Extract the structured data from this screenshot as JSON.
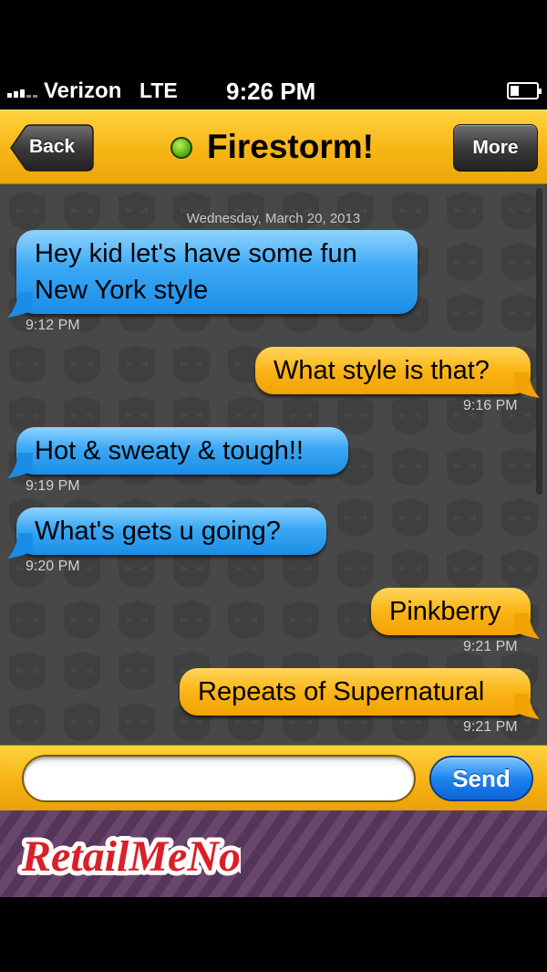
{
  "status_bar": {
    "carrier": "Verizon",
    "network": "LTE",
    "time": "9:26 PM",
    "battery_level": 0.35
  },
  "nav": {
    "back_label": "Back",
    "title": "Firestorm!",
    "more_label": "More",
    "online_color": "#5cb814"
  },
  "chat": {
    "date": "Wednesday, March 20, 2013",
    "messages": [
      {
        "direction": "incoming",
        "text_lines": [
          "Hey kid let's have some fun",
          "New York style"
        ],
        "time": "9:12 PM"
      },
      {
        "direction": "outgoing",
        "text_lines": [
          "What style is that?"
        ],
        "time": "9:16 PM"
      },
      {
        "direction": "incoming",
        "text_lines": [
          "Hot & sweaty & tough!!"
        ],
        "time": "9:19 PM"
      },
      {
        "direction": "incoming",
        "text_lines": [
          "What's gets u going?"
        ],
        "time": "9:20 PM"
      },
      {
        "direction": "outgoing",
        "text_lines": [
          "Pinkberry"
        ],
        "time": "9:21 PM"
      },
      {
        "direction": "outgoing",
        "text_lines": [
          "Repeats of Supernatural"
        ],
        "time": "9:21 PM"
      }
    ]
  },
  "composer": {
    "input_value": "",
    "send_label": "Send"
  },
  "ad": {
    "brand": "RetailMeNot"
  },
  "colors": {
    "accent_yellow": "#f7b515",
    "incoming_bubble": "#3ba8f5",
    "outgoing_bubble": "#fbb416",
    "chat_background": "#484848",
    "ad_background": "#5d3b5e"
  },
  "icons": [
    "signal-icon",
    "battery-icon",
    "online-status-icon",
    "retailmenot-logo"
  ]
}
